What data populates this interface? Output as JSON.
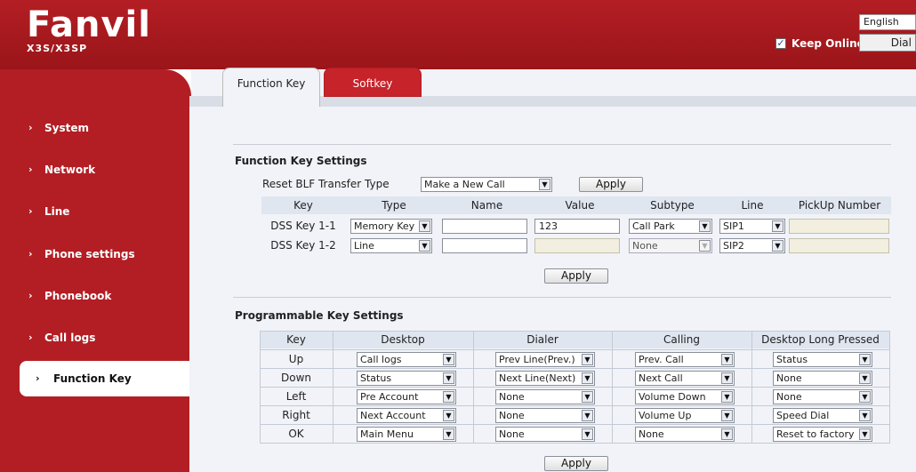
{
  "header": {
    "logo": "Fanvil",
    "model": "X3S/X3SP",
    "language": "English",
    "keep_online_label": "Keep Online",
    "keep_online_checked": true,
    "dial_button": "Dial"
  },
  "sidebar": {
    "items": [
      {
        "label": "System"
      },
      {
        "label": "Network"
      },
      {
        "label": "Line"
      },
      {
        "label": "Phone settings"
      },
      {
        "label": "Phonebook"
      },
      {
        "label": "Call logs"
      },
      {
        "label": "Function Key"
      }
    ],
    "active": "Function Key"
  },
  "tabs": [
    {
      "label": "Function Key"
    },
    {
      "label": "Softkey"
    }
  ],
  "function_key": {
    "title": "Function Key Settings",
    "reset_label": "Reset BLF Transfer Type",
    "reset_value": "Make a New Call",
    "apply_label": "Apply",
    "columns": [
      "Key",
      "Type",
      "Name",
      "Value",
      "Subtype",
      "Line",
      "PickUp Number"
    ],
    "rows": [
      {
        "key": "DSS Key 1-1",
        "type": "Memory Key",
        "name": "",
        "value": "123",
        "subtype": "Call Park",
        "line": "SIP1",
        "pickup": ""
      },
      {
        "key": "DSS Key 1-2",
        "type": "Line",
        "name": "",
        "value": "",
        "subtype": "None",
        "line": "SIP2",
        "pickup": ""
      }
    ],
    "apply_bottom_label": "Apply"
  },
  "programmable": {
    "title": "Programmable Key Settings",
    "columns": [
      "Key",
      "Desktop",
      "Dialer",
      "Calling",
      "Desktop Long Pressed"
    ],
    "rows": [
      {
        "key": "Up",
        "desktop": "Call logs",
        "dialer": "Prev Line(Prev.)",
        "calling": "Prev. Call",
        "long": "Status"
      },
      {
        "key": "Down",
        "desktop": "Status",
        "dialer": "Next Line(Next)",
        "calling": "Next Call",
        "long": "None"
      },
      {
        "key": "Left",
        "desktop": "Pre Account",
        "dialer": "None",
        "calling": "Volume Down",
        "long": "None"
      },
      {
        "key": "Right",
        "desktop": "Next Account",
        "dialer": "None",
        "calling": "Volume Up",
        "long": "Speed Dial"
      },
      {
        "key": "OK",
        "desktop": "Main Menu",
        "dialer": "None",
        "calling": "None",
        "long": "Reset to factory"
      }
    ],
    "apply_label": "Apply"
  },
  "colors": {
    "brand_red": "#b31e24",
    "page_bg": "#f1f3f8"
  }
}
